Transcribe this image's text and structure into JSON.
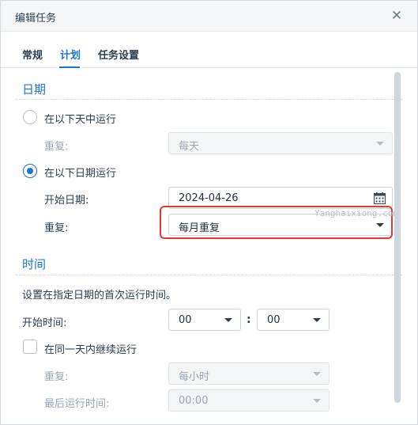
{
  "dialog": {
    "title": "编辑任务",
    "close_icon": "close-icon"
  },
  "tabs": [
    {
      "label": "常规",
      "active": false
    },
    {
      "label": "计划",
      "active": true
    },
    {
      "label": "任务设置",
      "active": false
    }
  ],
  "date_section": {
    "title": "日期",
    "option_daily": {
      "label": "在以下天中运行",
      "checked": false
    },
    "repeat_daily": {
      "label": "重复:",
      "value": "每天",
      "disabled": true
    },
    "option_date": {
      "label": "在以下日期运行",
      "checked": true
    },
    "start_date": {
      "label": "开始日期:",
      "value": "2024-04-26",
      "icon": "calendar-icon"
    },
    "repeat": {
      "label": "重复:",
      "value": "每月重复",
      "highlighted": true
    }
  },
  "time_section": {
    "title": "时间",
    "description": "设置在指定日期的首次运行时间。",
    "start_time": {
      "label": "开始时间:",
      "hour": "00",
      "separator": ":",
      "minute": "00"
    },
    "continue_same_day": {
      "label": "在同一天内继续运行",
      "checked": false
    },
    "repeat": {
      "label": "重复:",
      "value": "每小时",
      "disabled": true
    },
    "last_run": {
      "label": "最后运行时间:",
      "value": "00:00",
      "disabled": true
    }
  },
  "watermark": "Yanghaixiong.com",
  "colors": {
    "accent": "#1a73d9",
    "highlight_border": "#e8372e"
  }
}
